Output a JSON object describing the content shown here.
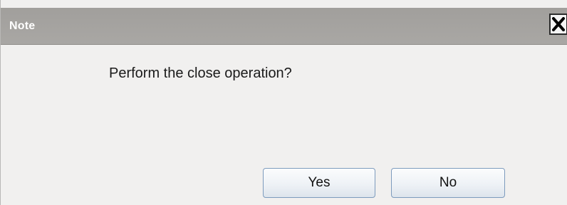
{
  "dialog": {
    "title": "Note",
    "close_icon": "close-icon",
    "message": "Perform the close operation?",
    "buttons": {
      "yes_label": "Yes",
      "no_label": "No"
    }
  },
  "colors": {
    "titlebar": "#a5a3a0",
    "background": "#f1f0ef",
    "button_border": "#7d9bbd"
  }
}
